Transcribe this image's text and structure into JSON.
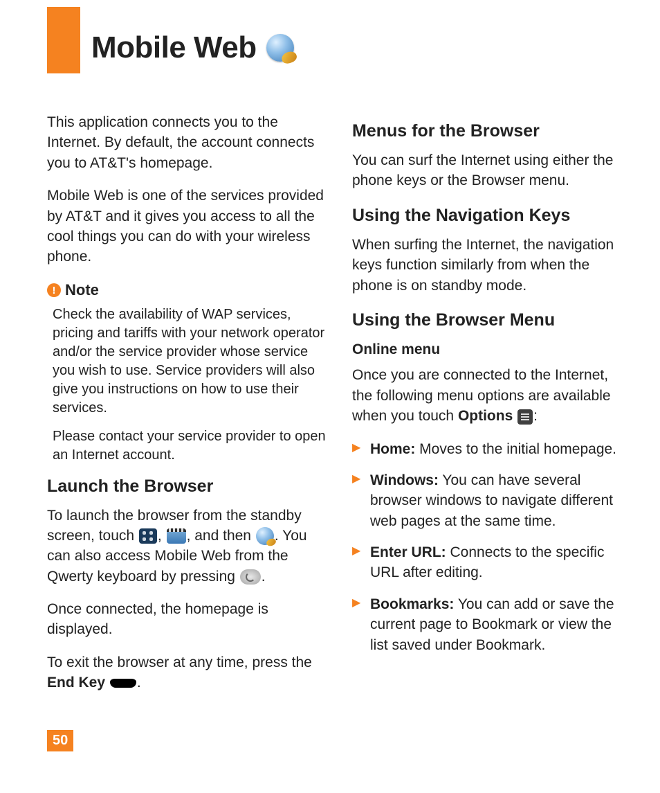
{
  "title": "Mobile Web",
  "pageNumber": "50",
  "left": {
    "intro1": "This application connects you to the Internet. By default, the account connects you to AT&T's homepage.",
    "intro2": "Mobile Web is one of the services provided by AT&T and it gives you access to all the cool things you can do with your wireless phone.",
    "noteLabel": "Note",
    "note1": "Check the availability of WAP services, pricing and tariffs with your network operator and/or the service provider whose service you wish to use. Service providers will also give you instructions on how to use their services.",
    "note2": "Please contact your service provider to open an Internet account.",
    "launchHeading": "Launch the Browser",
    "launchP1a": "To launch the browser from the standby screen, touch ",
    "launchP1b": ", ",
    "launchP1c": ", and then ",
    "launchP1d": ". You can also access Mobile Web from the Qwerty keyboard by pressing ",
    "launchP1e": ".",
    "launchP2": "Once connected, the homepage is displayed.",
    "launchP3a": "To exit the browser at any time, press the ",
    "endKey": "End Key",
    "launchP3b": " ",
    "launchP3c": "."
  },
  "right": {
    "menusHeading": "Menus for the Browser",
    "menusP": "You can surf the Internet using either the phone keys or the Browser menu.",
    "navHeading": "Using the Navigation Keys",
    "navP": "When surfing the Internet, the navigation keys function similarly from when the phone is on standby mode.",
    "browserMenuHeading": "Using the Browser Menu",
    "onlineMenu": "Online menu",
    "onlineP1a": "Once you are connected to the Internet, the following menu options are available when you touch ",
    "optionsLabel": "Options",
    "onlineP1b": " ",
    "onlineP1c": ":",
    "items": [
      {
        "label": "Home:",
        "text": " Moves to the initial homepage."
      },
      {
        "label": "Windows:",
        "text": " You can have several browser windows to navigate different web pages at the same time."
      },
      {
        "label": "Enter URL:",
        "text": " Connects to the specific URL after editing."
      },
      {
        "label": "Bookmarks:",
        "text": " You can add or save the current page to Bookmark or view the list saved under Bookmark."
      }
    ]
  }
}
